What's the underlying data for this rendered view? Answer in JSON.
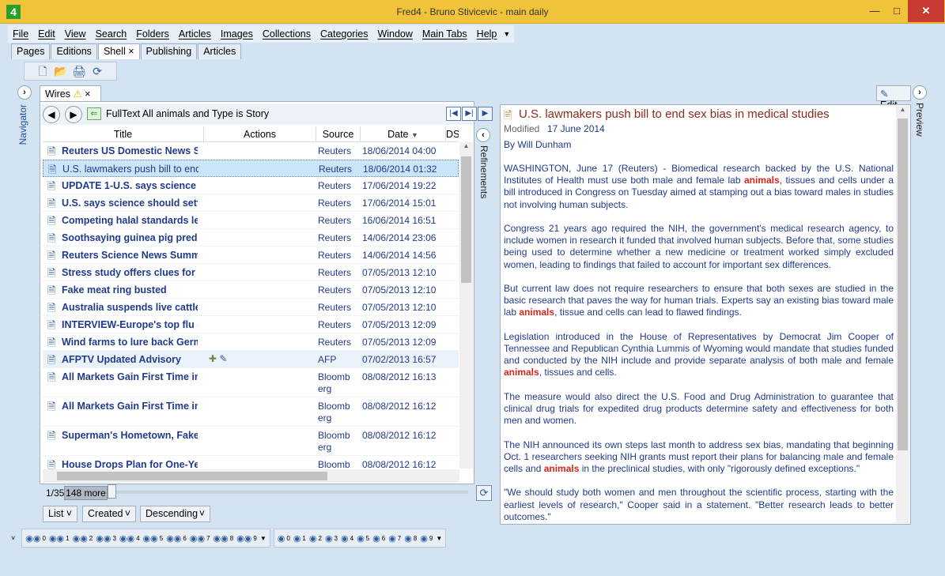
{
  "window": {
    "title": "Fred4 - Bruno Stivicevic - main daily",
    "app_icon": "4"
  },
  "menu": [
    "File",
    "Edit",
    "View",
    "Search",
    "Folders",
    "Articles",
    "Images",
    "Collections",
    "Categories",
    "Window",
    "Main Tabs",
    "Help"
  ],
  "top_tabs": [
    "Pages",
    "Editions",
    "Shell",
    "Publishing",
    "Articles"
  ],
  "navigator_label": "Navigator",
  "wires_tab": {
    "label": "Wires"
  },
  "query": "FullText All animals and Type is Story",
  "columns": {
    "title": "Title",
    "actions": "Actions",
    "source": "Source",
    "date": "Date",
    "ds": "DS"
  },
  "rows": [
    {
      "title": "Reuters US Domestic News Summ",
      "source": "Reuters",
      "date": "18/06/2014 04:00"
    },
    {
      "title": "U.S. lawmakers push bill to end",
      "source": "Reuters",
      "date": "18/06/2014 01:32"
    },
    {
      "title": "UPDATE 1-U.S. says science she",
      "source": "Reuters",
      "date": "17/06/2014 19:22"
    },
    {
      "title": "U.S. says science should settle",
      "source": "Reuters",
      "date": "17/06/2014 15:01"
    },
    {
      "title": "Competing halal standards leav",
      "source": "Reuters",
      "date": "16/06/2014 16:51"
    },
    {
      "title": "Soothsaying guinea pig predict",
      "source": "Reuters",
      "date": "14/06/2014 23:06"
    },
    {
      "title": "Reuters Science News Summa",
      "source": "Reuters",
      "date": "14/06/2014 14:56"
    },
    {
      "title": "Stress study offers clues for ne",
      "source": "Reuters",
      "date": "07/05/2013 12:10"
    },
    {
      "title": "Fake meat ring busted",
      "source": "Reuters",
      "date": "07/05/2013 12:10"
    },
    {
      "title": "Australia suspends live cattle e",
      "source": "Reuters",
      "date": "07/05/2013 12:10"
    },
    {
      "title": "INTERVIEW-Europe's top flu ex",
      "source": "Reuters",
      "date": "07/05/2013 12:09"
    },
    {
      "title": "Wind farms to lure back Germ",
      "source": "Reuters",
      "date": "07/05/2013 12:09"
    },
    {
      "title": "AFPTV Updated Advisory",
      "source": "AFP",
      "date": "07/02/2013 16:57"
    },
    {
      "title": "All Markets Gain First Time in T",
      "source": "Bloomb erg",
      "date": "08/08/2012 16:13"
    },
    {
      "title": "All Markets Gain First Time in T",
      "source": "Bloomb erg",
      "date": "08/08/2012 16:12"
    },
    {
      "title": "Superman's Hometown, Fake C",
      "source": "Bloomb erg",
      "date": "08/08/2012 16:12"
    },
    {
      "title": "House Drops Plan for One-Yea",
      "source": "Bloomb",
      "date": "08/08/2012 16:12"
    }
  ],
  "refinements_label": "Refinements",
  "paging": {
    "position": "1/35",
    "more": "148 more"
  },
  "dropdowns": {
    "view": "List",
    "sort_field": "Created",
    "sort_order": "Descending"
  },
  "edit_button": "Edit",
  "preview_label": "Preview",
  "article": {
    "title": "U.S. lawmakers push bill to end sex bias in medical studies",
    "modified_label": "Modified",
    "modified_date": "17 June 2014",
    "byline": "By Will Dunham",
    "p1a": "WASHINGTON, June 17 (Reuters) - Biomedical research backed by the U.S. National Institutes of Health must use both male and female lab ",
    "p1b": ", tissues and cells under a bill introduced in Congress on Tuesday aimed at stamping out a bias toward males in studies not involving human subjects.",
    "p2": "Congress 21 years ago required the NIH, the government's medical research agency, to include women in research it funded that involved human subjects. Before that, some studies being used to determine whether a new medicine or treatment worked simply excluded women, leading to findings that failed to account for important sex differences.",
    "p3a": "But current law does not require researchers to ensure that both sexes are studied in the basic research that paves the way for human trials. Experts say an existing bias toward male lab ",
    "p3b": ", tissue and cells can lead to flawed findings.",
    "p4a": "Legislation introduced in the House of Representatives by Democrat Jim Cooper of Tennessee and Republican Cynthia Lummis of Wyoming would mandate that studies funded and conducted by the NIH include and provide separate analysis of both male and female ",
    "p4b": ", tissues and cells.",
    "p5": "The measure would also direct the U.S. Food and Drug Administration to guarantee that clinical drug trials for expedited drug products determine safety and effectiveness for both men and women.",
    "p6a": "The NIH announced its own steps last month to address sex bias, mandating that beginning Oct. 1 researchers seeking NIH grants must report their plans for balancing male and female cells and ",
    "p6b": " in the preclinical studies, with only \"rigorously defined exceptions.\"",
    "p7": "\"We should study both women and men throughout the scientific process, starting with the earliest levels of research,\" Cooper said in a statement. \"Better research leads to better outcomes.\"",
    "highlight": "animals"
  },
  "bottom_numbers": [
    "0",
    "1",
    "2",
    "3",
    "4",
    "5",
    "6",
    "7",
    "8",
    "9"
  ],
  "colors": {
    "titlebar": "#f1c33a",
    "close": "#c73b33",
    "link": "#1f3b8c",
    "highlight": "#d8261c"
  }
}
